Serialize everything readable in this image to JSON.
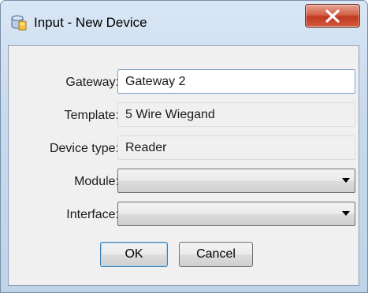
{
  "window": {
    "title": "Input - New Device"
  },
  "form": {
    "gateway": {
      "label": "Gateway:",
      "value": "Gateway  2"
    },
    "template": {
      "label": "Template:",
      "value": "5 Wire Wiegand"
    },
    "device_type": {
      "label": "Device type:",
      "value": "Reader"
    },
    "module": {
      "label": "Module:",
      "value": ""
    },
    "interface": {
      "label": "Interface:",
      "value": ""
    }
  },
  "buttons": {
    "ok_label": "OK",
    "cancel_label": "Cancel"
  },
  "icons": {
    "app": "database-device-icon",
    "close": "close-icon",
    "dropdown": "chevron-down-icon"
  },
  "colors": {
    "close_button": "#c7452a",
    "title_gradient": "#c8daee",
    "dialog_body": "#f0f0f0"
  }
}
